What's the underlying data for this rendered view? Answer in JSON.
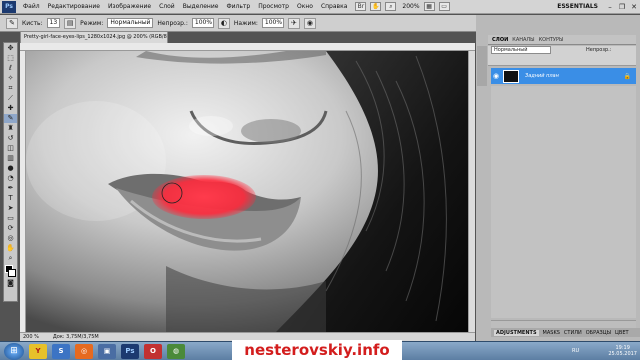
{
  "app": {
    "logo": "Ps",
    "menu": [
      "Файл",
      "Редактирование",
      "Изображение",
      "Слой",
      "Выделение",
      "Фильтр",
      "Просмотр",
      "Окно",
      "Справка"
    ],
    "zoom": "200%",
    "workspace": "ESSENTIALS"
  },
  "options": {
    "brush_label": "Кисть:",
    "brush_size": "13",
    "mode_label": "Режим:",
    "mode_value": "Нормальный",
    "opacity_label": "Непрозр.:",
    "opacity_value": "100%",
    "pressure_label": "Нажим:",
    "pressure_value": "100%"
  },
  "document": {
    "tab_title": "Pretty-girl-face-eyes-lips_1280x1024.jpg @ 200% (RGB/8) *",
    "status_zoom": "200 %",
    "status_doc": "Док: 3,75М/3,75М"
  },
  "panels": {
    "tabs": [
      "СЛОИ",
      "КАНАЛЫ",
      "КОНТУРЫ"
    ],
    "blend_mode": "Нормальный",
    "opacity_label": "Непрозр.:",
    "layer_name": "Задний план",
    "bottom_tabs": [
      "ADJUSTMENTS",
      "MASKS",
      "СТИЛИ",
      "ОБРАЗЦЫ",
      "ЦВЕТ"
    ]
  },
  "taskbar": {
    "watermark": "nesterovskiy.info",
    "lang": "RU",
    "time": "19:19",
    "date": "25.05.2017"
  },
  "colors": {
    "lip_highlight": "#ff2a3c",
    "layer_selected": "#3a8ee6",
    "watermark_red": "#d31d1d"
  },
  "icons": [
    "brush-icon",
    "mode-icon",
    "airbrush-icon",
    "eye-icon",
    "lock-icon",
    "start-icon"
  ]
}
